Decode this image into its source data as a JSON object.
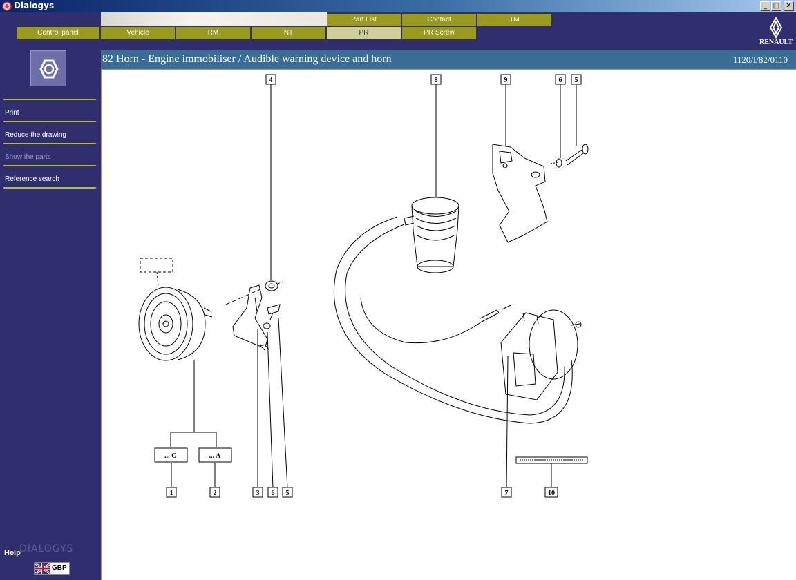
{
  "window": {
    "title": "Dialogys",
    "controls": [
      "_",
      "□",
      "✕"
    ]
  },
  "tabs_top": [
    {
      "label": "Part List"
    },
    {
      "label": "Contact"
    },
    {
      "label": "TM"
    }
  ],
  "tabs_bottom": [
    {
      "label": "Control panel"
    },
    {
      "label": "Vehicle"
    },
    {
      "label": "RM"
    },
    {
      "label": "NT"
    },
    {
      "label": "PR",
      "active": true
    },
    {
      "label": "PR Screw"
    }
  ],
  "brand_logo": "RENAULT",
  "sidebar": {
    "menu": [
      {
        "label": "Print",
        "enabled": true
      },
      {
        "label": "Reduce the drawing",
        "enabled": true
      },
      {
        "label": "Show the parts",
        "enabled": false
      },
      {
        "label": "Reference search",
        "enabled": true
      }
    ],
    "help_label": "Help",
    "watermark": "DIALOGYS",
    "language_code": "GBP"
  },
  "page": {
    "title": "82 Horn - Engine immobiliser / Audible warning device and horn",
    "reference": "1120/I/82/0110"
  },
  "diagram": {
    "callouts": [
      "4",
      "8",
      "9",
      "6",
      "5",
      "1",
      "2",
      "3",
      "6",
      "5",
      "7",
      "10"
    ],
    "variant_labels": [
      "... G",
      "... A"
    ]
  },
  "colors": {
    "accent": "#9a9a1e",
    "sidebar": "#2f2f6f",
    "titleband": "#3a6d96"
  }
}
